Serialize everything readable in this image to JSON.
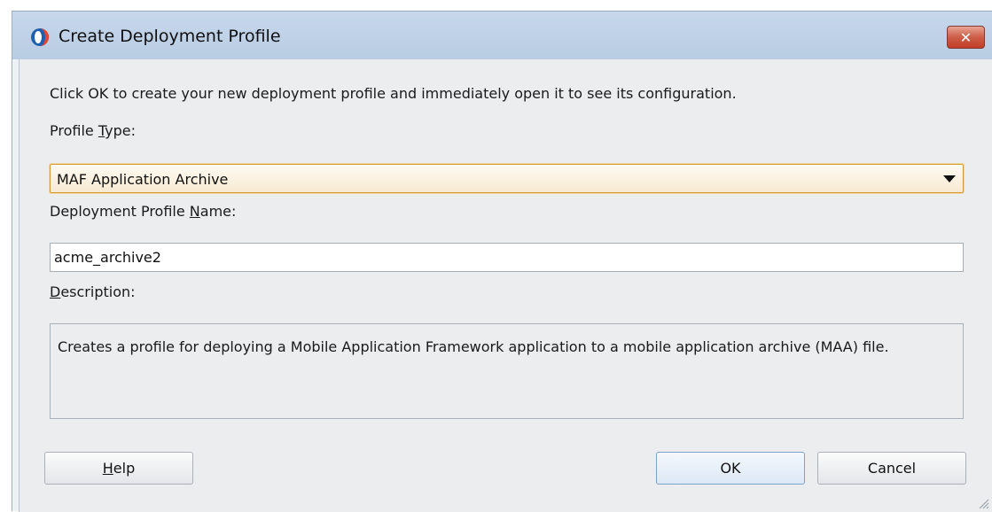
{
  "window": {
    "title": "Create Deployment Profile",
    "close_glyph": "✕"
  },
  "instructions": "Click OK to create your new deployment profile and immediately open it to see its configuration.",
  "profile_type": {
    "label_prefix": "Profile ",
    "label_mnemonic": "T",
    "label_suffix": "ype:",
    "selected_value": "MAF Application Archive"
  },
  "profile_name": {
    "label_prefix": "Deployment Profile ",
    "label_mnemonic": "N",
    "label_suffix": "ame:",
    "value": "acme_archive2"
  },
  "description": {
    "label_mnemonic": "D",
    "label_suffix": "escription:",
    "text": "Creates a profile for deploying a Mobile Application Framework application to a mobile application archive (MAA) file."
  },
  "buttons": {
    "help_mnemonic": "H",
    "help_suffix": "elp",
    "ok": "OK",
    "cancel": "Cancel"
  },
  "icons": {
    "title_icon": "oracle-jdeveloper-icon",
    "close_icon": "close-icon",
    "dropdown_icon": "chevron-down-icon",
    "resize_grip": "resize-grip-icon"
  },
  "colors": {
    "titlebar": "#c7d8ec",
    "close_button": "#c94a33",
    "select_focus_border": "#d49a3a",
    "ok_border": "#7da2ce"
  }
}
